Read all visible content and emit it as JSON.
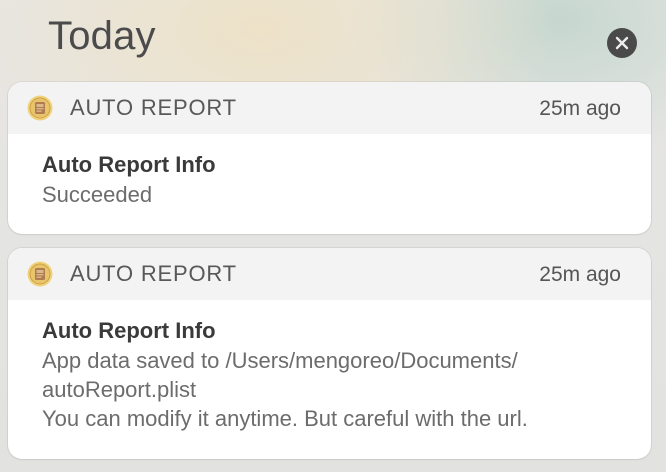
{
  "header": {
    "title": "Today",
    "clear_icon": "close-circle-icon"
  },
  "notifications": [
    {
      "app_name": "AUTO REPORT",
      "app_icon": "auto-report-app-icon",
      "time": "25m ago",
      "title": "Auto Report Info",
      "lines": [
        "Succeeded"
      ]
    },
    {
      "app_name": "AUTO REPORT",
      "app_icon": "auto-report-app-icon",
      "time": "25m ago",
      "title": "Auto Report Info",
      "lines": [
        "App data saved to /Users/mengoreo/Documents/",
        "autoReport.plist",
        "You can modify it anytime. But careful with the url."
      ]
    }
  ],
  "colors": {
    "icon_gold": "#e9c46a",
    "icon_brown": "#b07c4f"
  }
}
